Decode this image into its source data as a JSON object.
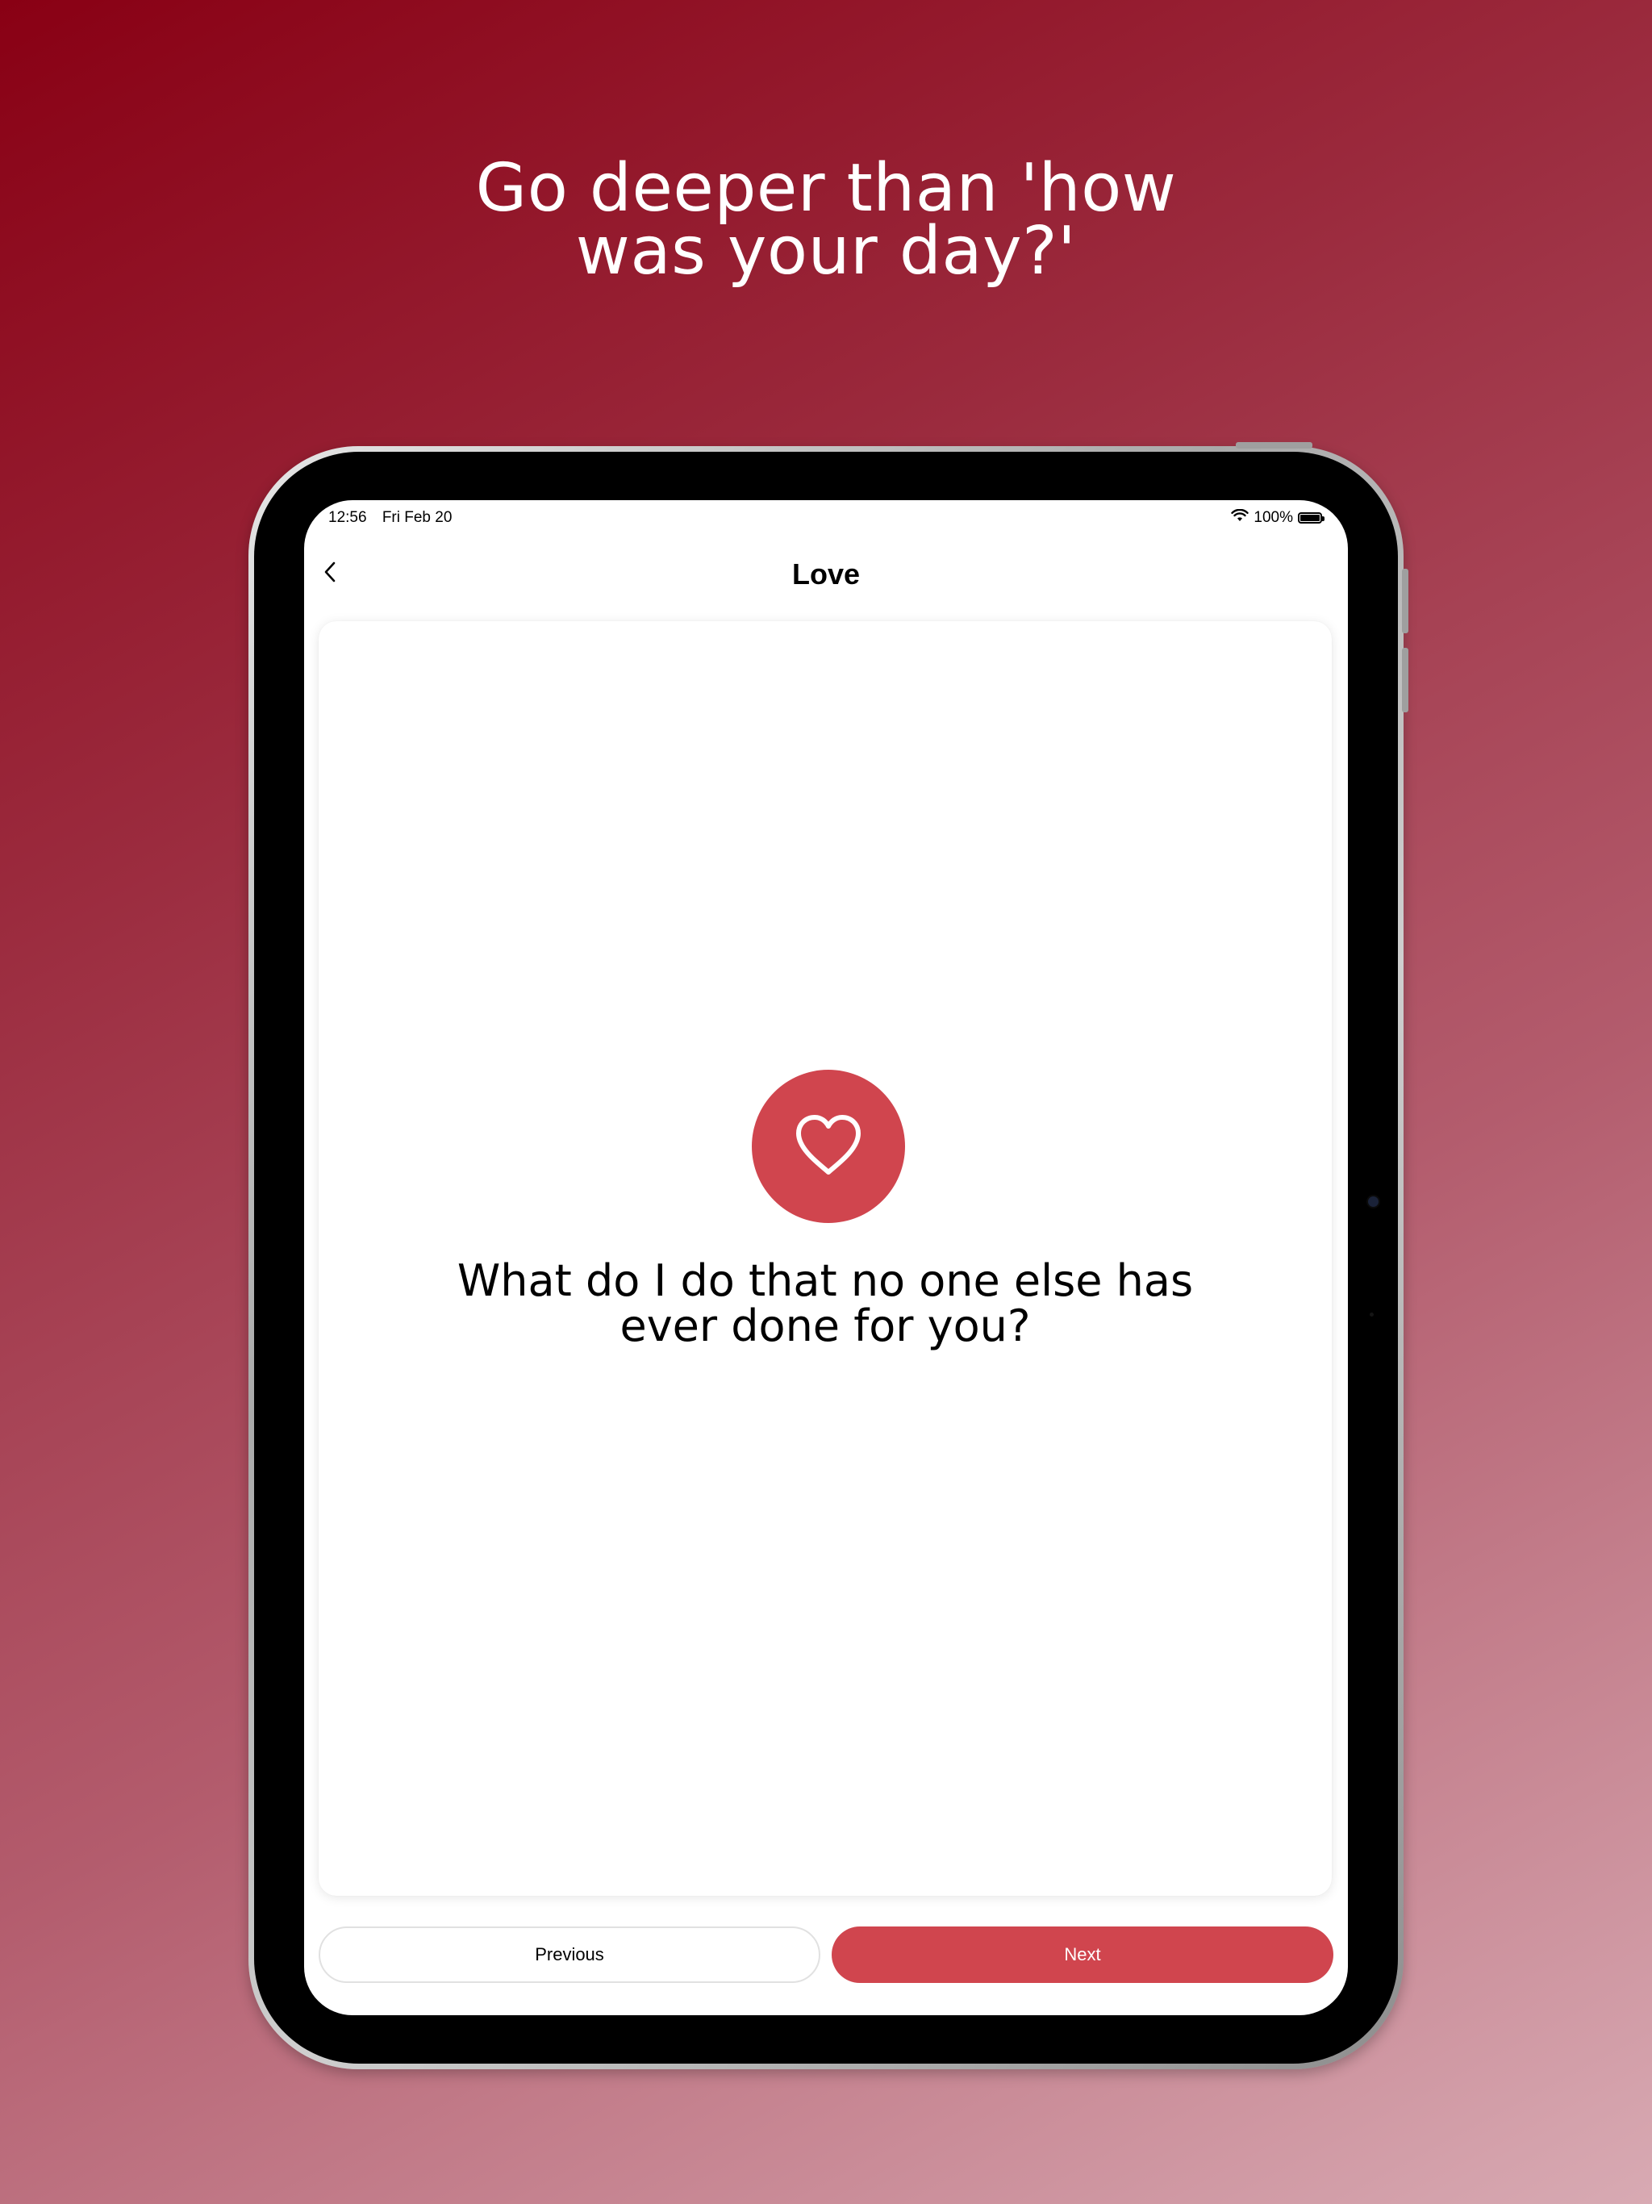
{
  "headline": {
    "line1": "Go deeper than 'how",
    "line2": "was your day?'"
  },
  "status_bar": {
    "time": "12:56",
    "date": "Fri Feb 20",
    "battery": "100%",
    "wifi_icon": "wifi-icon",
    "battery_icon": "battery-icon"
  },
  "nav": {
    "title": "Love",
    "back_icon": "chevron-left-icon"
  },
  "card": {
    "icon": "heart-icon",
    "question_line1": "What do I do that no one else has",
    "question_line2": "ever done for you?"
  },
  "buttons": {
    "previous": "Previous",
    "next": "Next"
  },
  "colors": {
    "accent": "#d0454e",
    "background_top": "#890014",
    "background_bottom": "#d8aab3"
  }
}
